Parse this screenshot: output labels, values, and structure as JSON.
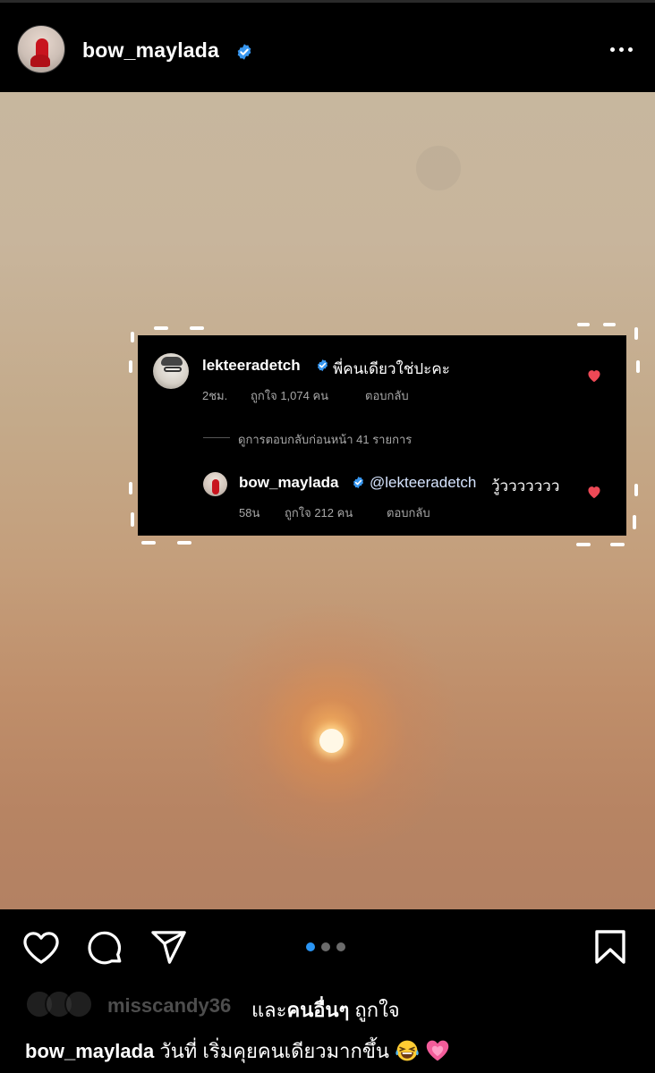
{
  "post": {
    "username": "bow_maylada"
  },
  "comment": {
    "username": "lekteeradetch",
    "text": "พี่คนเดียวใช่ปะคะ",
    "time": "2ชม.",
    "likes": "ถูกใจ 1,074 คน",
    "reply_label": "ตอบกลับ",
    "view_previous": "ดูการตอบกลับก่อนหน้า 41 รายการ"
  },
  "reply": {
    "username": "bow_maylada",
    "mention": "@lekteeradetch",
    "text": "วู้ววววววว",
    "time": "58น",
    "likes": "ถูกใจ 212 คน",
    "reply_label": "ตอบกลับ"
  },
  "carousel": {
    "total": 3,
    "active": 1
  },
  "likes_line": {
    "first_user": "misscandy36",
    "rest_prefix": "และ",
    "others": "คนอื่นๆ",
    "suffix": " ถูกใจ"
  },
  "caption": {
    "username": "bow_maylada",
    "text": " วันที่ เริ่มคุยคนเดียวมากขึ้น"
  },
  "colors": {
    "verified": "#3897f0",
    "heart": "#ed4956",
    "dot_active": "#2a95f4"
  }
}
